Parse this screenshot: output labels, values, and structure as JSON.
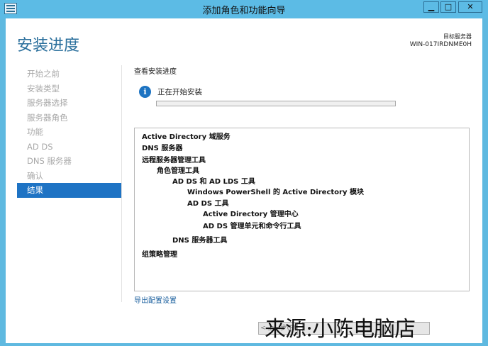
{
  "window": {
    "title": "添加角色和功能向导",
    "min_glyph": "▁",
    "max_glyph": "□",
    "close_glyph": "✕"
  },
  "header": {
    "title": "安装进度",
    "destination_label": "目标服务器",
    "destination_server": "WIN-017IRDNME0H"
  },
  "nav": {
    "items": [
      {
        "label": "开始之前",
        "active": false
      },
      {
        "label": "安装类型",
        "active": false
      },
      {
        "label": "服务器选择",
        "active": false
      },
      {
        "label": "服务器角色",
        "active": false
      },
      {
        "label": "功能",
        "active": false
      },
      {
        "label": "AD DS",
        "active": false
      },
      {
        "label": "DNS 服务器",
        "active": false
      },
      {
        "label": "确认",
        "active": false
      },
      {
        "label": "结果",
        "active": true
      }
    ]
  },
  "main": {
    "section_title": "查看安装进度",
    "status_text": "正在开始安装",
    "progress_fraction": 0.0,
    "features": [
      {
        "label": "Active Directory 域服务",
        "level": 0
      },
      {
        "label": "DNS 服务器",
        "level": 0
      },
      {
        "label": "远程服务器管理工具",
        "level": 0
      },
      {
        "label": "角色管理工具",
        "level": 1
      },
      {
        "label": "AD DS 和 AD LDS 工具",
        "level": 2
      },
      {
        "label": "Windows PowerShell 的 Active Directory 模块",
        "level": 3
      },
      {
        "label": "AD DS 工具",
        "level": 3
      },
      {
        "label": "Active Directory 管理中心",
        "level": 4
      },
      {
        "label": "AD DS 管理单元和命令行工具",
        "level": 4
      },
      {
        "label": "DNS 服务器工具",
        "level": 2
      },
      {
        "label": "组策略管理",
        "level": 0
      }
    ],
    "export_link": "导出配置设置"
  },
  "footer": {
    "previous": "< 上一步(P)"
  },
  "watermark": "来源:小陈电脑店"
}
